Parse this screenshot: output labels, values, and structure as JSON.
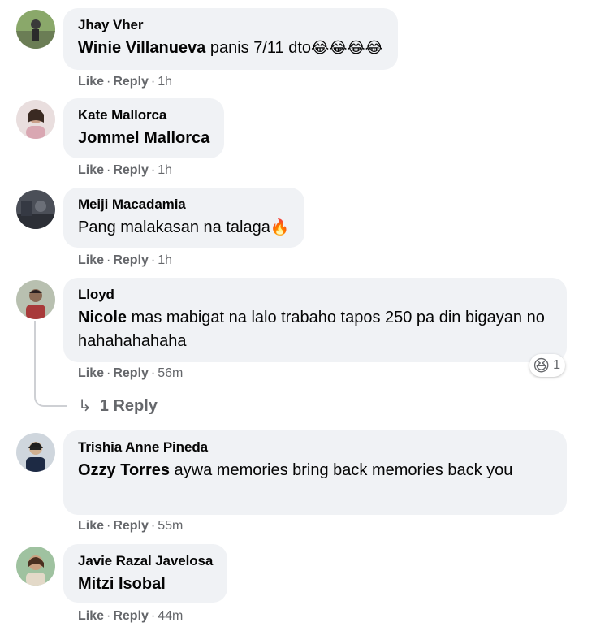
{
  "actions": {
    "like": "Like",
    "reply": "Reply",
    "separator": "·"
  },
  "comments": [
    {
      "author": "Jhay Vher",
      "mention": "Winie Villanueva",
      "text": " panis 7/11 dto",
      "emoji": "😂😂😂😂",
      "time": "1h"
    },
    {
      "author": "Kate Mallorca",
      "mention": "Jommel Mallorca",
      "text": "",
      "emoji": "",
      "time": "1h"
    },
    {
      "author": "Meiji Macadamia",
      "mention": "",
      "text": "Pang malakasan na talaga",
      "emoji": "🔥",
      "time": "1h"
    },
    {
      "author": "Lloyd",
      "mention": "Nicole",
      "text": " mas mabigat na lalo trabaho tapos 250 pa din bigayan no hahahahahaha",
      "emoji": "",
      "time": "56m",
      "reaction_emoji": "😆",
      "reaction_count": "1",
      "replies_label": "1 Reply"
    },
    {
      "author": "Trishia Anne Pineda",
      "mention": "Ozzy Torres",
      "text": " aywa memories bring back memories back you",
      "emoji": "",
      "time": "55m"
    },
    {
      "author": "Javie Razal Javelosa",
      "mention": "Mitzi Isobal",
      "text": "",
      "emoji": "",
      "time": "44m"
    }
  ],
  "icons": {
    "reply_arrow": "reply-arrow-icon",
    "reaction": "laughing-emoji-icon"
  },
  "colors": {
    "bubble": "#f0f2f5",
    "secondary_text": "#65676b",
    "primary_text": "#050505"
  }
}
